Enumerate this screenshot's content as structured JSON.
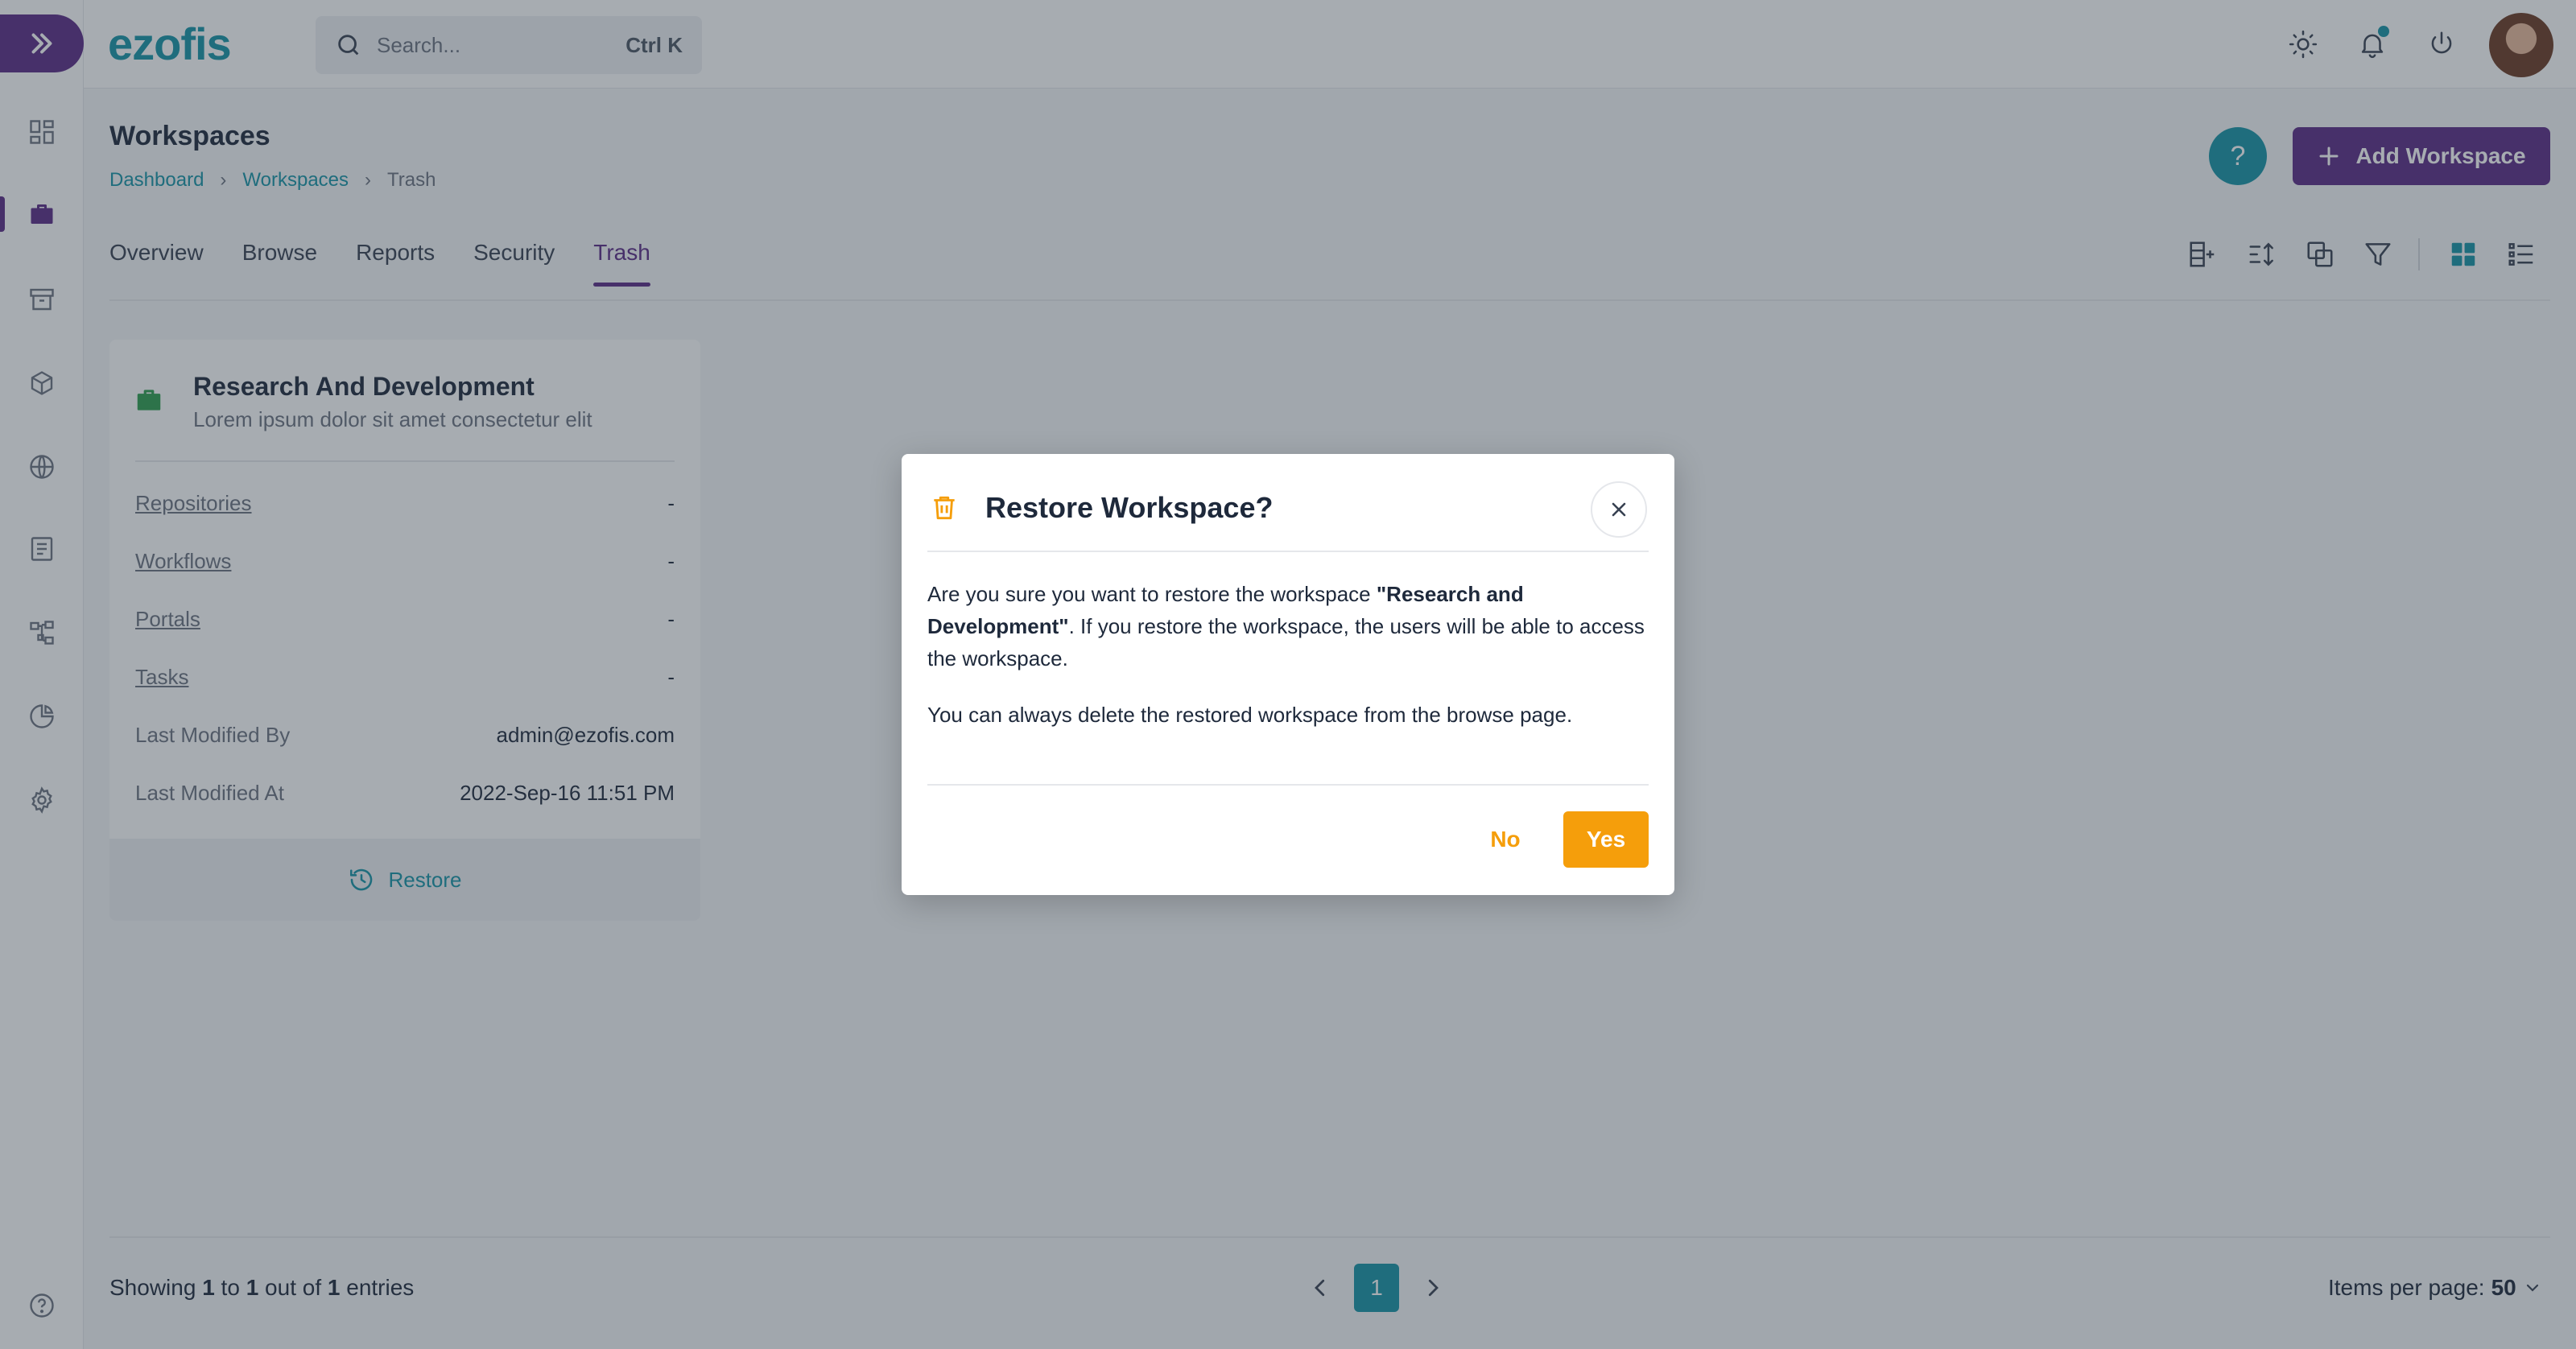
{
  "app": {
    "logo_text": "ezofis",
    "accent": "#5b2a86",
    "brand": "#1593a5"
  },
  "search": {
    "placeholder": "Search...",
    "shortcut": "Ctrl K"
  },
  "sidebar": {
    "items": [
      {
        "icon": "dashboard-icon",
        "active": false
      },
      {
        "icon": "briefcase-icon",
        "active": true
      },
      {
        "icon": "archive-icon",
        "active": false
      },
      {
        "icon": "cube-icon",
        "active": false
      },
      {
        "icon": "globe-icon",
        "active": false
      },
      {
        "icon": "document-icon",
        "active": false
      },
      {
        "icon": "workflow-icon",
        "active": false
      },
      {
        "icon": "pie-chart-icon",
        "active": false
      },
      {
        "icon": "gear-icon",
        "active": false
      }
    ],
    "help_icon": "help-circle-icon"
  },
  "header": {
    "title": "Workspaces",
    "breadcrumb": [
      "Dashboard",
      "Workspaces",
      "Trash"
    ],
    "add_button": "Add Workspace",
    "help_button": "?"
  },
  "tabs": [
    "Overview",
    "Browse",
    "Reports",
    "Security",
    "Trash"
  ],
  "active_tab": "Trash",
  "card": {
    "title": "Research And Development",
    "description": "Lorem ipsum dolor sit amet consectetur elit",
    "rows": [
      {
        "label": "Repositories",
        "value": "-"
      },
      {
        "label": "Workflows",
        "value": "-"
      },
      {
        "label": "Portals",
        "value": "-"
      },
      {
        "label": "Tasks",
        "value": "-"
      },
      {
        "label": "Last Modified By",
        "value": "admin@ezofis.com"
      },
      {
        "label": "Last Modified At",
        "value": "2022-Sep-16 11:51 PM"
      }
    ],
    "restore_label": "Restore"
  },
  "footer": {
    "showing_prefix": "Showing",
    "from": "1",
    "to_word": "to",
    "to": "1",
    "out_of_word": "out of",
    "total": "1",
    "entries_word": "entries",
    "current_page": "1",
    "per_page_label": "Items per page:",
    "per_page_value": "50"
  },
  "modal": {
    "title": "Restore Workspace?",
    "body_pre": "Are you sure you want to restore the workspace ",
    "body_bold": "\"Research and Development\"",
    "body_post": ". If you restore the workspace, the users will be able to access the workspace.",
    "body_second": "You can always delete the restored workspace from the browse page.",
    "no_label": "No",
    "yes_label": "Yes",
    "yes_color": "#f59e0b"
  }
}
